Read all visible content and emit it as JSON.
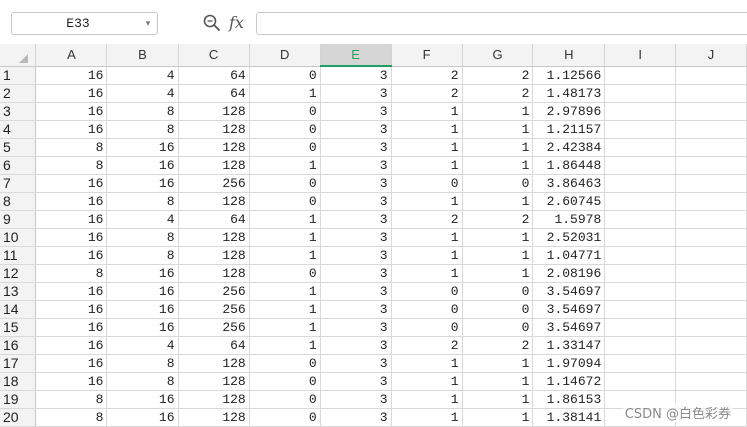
{
  "formula_bar": {
    "name_box": "E33",
    "fx": "fx",
    "formula": ""
  },
  "columns": [
    "A",
    "B",
    "C",
    "D",
    "E",
    "F",
    "G",
    "H",
    "I",
    "J"
  ],
  "selected_column": "E",
  "rows": [
    {
      "n": "1",
      "v": [
        "16",
        "4",
        "64",
        "0",
        "3",
        "2",
        "2",
        "1.12566"
      ]
    },
    {
      "n": "2",
      "v": [
        "16",
        "4",
        "64",
        "1",
        "3",
        "2",
        "2",
        "1.48173"
      ]
    },
    {
      "n": "3",
      "v": [
        "16",
        "8",
        "128",
        "0",
        "3",
        "1",
        "1",
        "2.97896"
      ]
    },
    {
      "n": "4",
      "v": [
        "16",
        "8",
        "128",
        "0",
        "3",
        "1",
        "1",
        "1.21157"
      ]
    },
    {
      "n": "5",
      "v": [
        "8",
        "16",
        "128",
        "0",
        "3",
        "1",
        "1",
        "2.42384"
      ]
    },
    {
      "n": "6",
      "v": [
        "8",
        "16",
        "128",
        "1",
        "3",
        "1",
        "1",
        "1.86448"
      ]
    },
    {
      "n": "7",
      "v": [
        "16",
        "16",
        "256",
        "0",
        "3",
        "0",
        "0",
        "3.86463"
      ]
    },
    {
      "n": "8",
      "v": [
        "16",
        "8",
        "128",
        "0",
        "3",
        "1",
        "1",
        "2.60745"
      ]
    },
    {
      "n": "9",
      "v": [
        "16",
        "4",
        "64",
        "1",
        "3",
        "2",
        "2",
        "1.5978"
      ]
    },
    {
      "n": "10",
      "v": [
        "16",
        "8",
        "128",
        "1",
        "3",
        "1",
        "1",
        "2.52031"
      ]
    },
    {
      "n": "11",
      "v": [
        "16",
        "8",
        "128",
        "1",
        "3",
        "1",
        "1",
        "1.04771"
      ]
    },
    {
      "n": "12",
      "v": [
        "8",
        "16",
        "128",
        "0",
        "3",
        "1",
        "1",
        "2.08196"
      ]
    },
    {
      "n": "13",
      "v": [
        "16",
        "16",
        "256",
        "1",
        "3",
        "0",
        "0",
        "3.54697"
      ]
    },
    {
      "n": "14",
      "v": [
        "16",
        "16",
        "256",
        "1",
        "3",
        "0",
        "0",
        "3.54697"
      ]
    },
    {
      "n": "15",
      "v": [
        "16",
        "16",
        "256",
        "1",
        "3",
        "0",
        "0",
        "3.54697"
      ]
    },
    {
      "n": "16",
      "v": [
        "16",
        "4",
        "64",
        "1",
        "3",
        "2",
        "2",
        "1.33147"
      ]
    },
    {
      "n": "17",
      "v": [
        "16",
        "8",
        "128",
        "0",
        "3",
        "1",
        "1",
        "1.97094"
      ]
    },
    {
      "n": "18",
      "v": [
        "16",
        "8",
        "128",
        "0",
        "3",
        "1",
        "1",
        "1.14672"
      ]
    },
    {
      "n": "19",
      "v": [
        "8",
        "16",
        "128",
        "0",
        "3",
        "1",
        "1",
        "1.86153"
      ]
    },
    {
      "n": "20",
      "v": [
        "8",
        "16",
        "128",
        "0",
        "3",
        "1",
        "1",
        "1.38141"
      ]
    }
  ],
  "watermark": "CSDN @白色彩券",
  "colors": {
    "accent": "#1f9e62",
    "header_bg": "#f3f3f3",
    "gridline": "#d9d9d9"
  }
}
